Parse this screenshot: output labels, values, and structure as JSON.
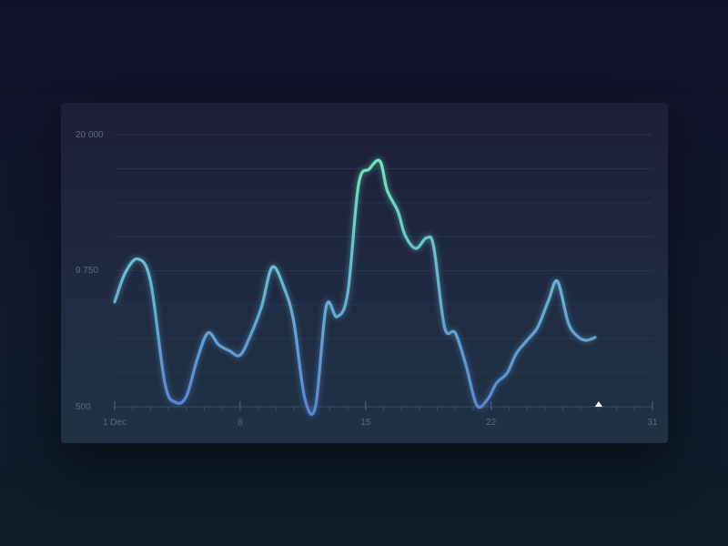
{
  "chart_data": {
    "type": "line",
    "x_ticks": [
      {
        "day": 1,
        "label": "1 Dec"
      },
      {
        "day": 8,
        "label": "8"
      },
      {
        "day": 15,
        "label": "15"
      },
      {
        "day": 22,
        "label": "22"
      },
      {
        "day": 31,
        "label": "31"
      }
    ],
    "y_ticks": [
      {
        "value": 500,
        "label": "500"
      },
      {
        "value": 9750,
        "label": "9 750"
      },
      {
        "value": 20000,
        "label": "20 000"
      }
    ],
    "xlim": [
      1,
      31
    ],
    "ylim": [
      500,
      20000
    ],
    "grid": true,
    "series": [
      {
        "x": [
          1,
          1.6,
          2.3,
          3.0,
          3.8,
          4.4,
          5.0,
          5.6,
          6.2,
          6.8,
          7.4,
          8.0,
          8.6,
          9.2,
          9.8,
          10.5,
          11.0,
          11.6,
          12.2,
          12.8,
          13.4,
          14.0,
          14.6,
          15.2,
          15.8,
          16.2,
          16.8,
          17.2,
          17.8,
          18.4,
          18.8,
          19.4,
          20.0,
          20.6,
          21.2,
          21.8,
          22.3,
          22.9,
          23.4,
          24.0,
          24.6,
          25.2,
          25.7,
          26.3,
          26.8,
          27.3,
          27.8
        ],
        "y": [
          7600,
          9600,
          10600,
          9000,
          2100,
          800,
          1200,
          3700,
          5500,
          4700,
          4300,
          4000,
          5400,
          7300,
          10000,
          8400,
          6200,
          1100,
          500,
          7300,
          6600,
          8200,
          16200,
          17400,
          18000,
          15800,
          14200,
          12400,
          11400,
          12200,
          11500,
          5900,
          5500,
          3300,
          600,
          1000,
          2100,
          2800,
          4100,
          5000,
          5900,
          7700,
          9000,
          6200,
          5300,
          5000,
          5200
        ],
        "colors": [
          "#6ff2b4",
          "#66bcd2",
          "#5b86d8"
        ]
      }
    ],
    "marker_day": 28
  }
}
